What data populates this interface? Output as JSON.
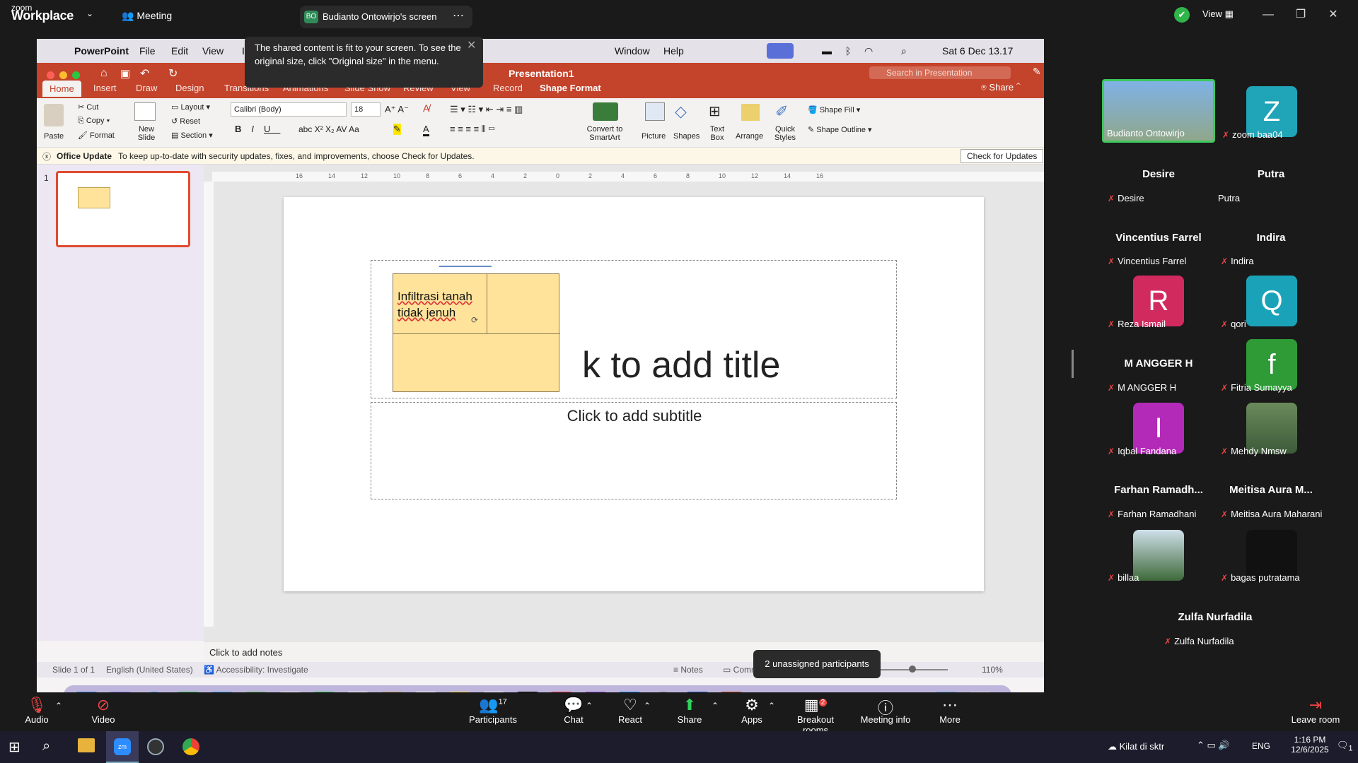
{
  "zoom": {
    "logo_top": "zoom",
    "logo_bottom": "Workplace",
    "meeting_label": "Meeting",
    "share_badge": "BO",
    "share_title": "Budianto Ontowirjo's screen",
    "view_label": "View"
  },
  "tooltip": {
    "text": "The shared content is fit to your screen. To see the original size, click \"Original size\" in the menu."
  },
  "mac_menu": {
    "apple": "",
    "app": "PowerPoint",
    "items": [
      "File",
      "Edit",
      "View",
      "In"
    ],
    "right": [
      "Window",
      "Help"
    ],
    "datetime": "Sat 6 Dec  13.17"
  },
  "ppt": {
    "title": "Presentation1",
    "search_placeholder": "Search in Presentation",
    "share": "Share",
    "tabs": [
      "Home",
      "Insert",
      "Draw",
      "Design",
      "Transitions",
      "Animations",
      "Slide Show",
      "Review",
      "View",
      "Record",
      "Shape Format"
    ],
    "ribbon": {
      "paste": "Paste",
      "cut": "Cut",
      "copy": "Copy",
      "format": "Format",
      "new_slide": "New Slide",
      "layout": "Layout",
      "reset": "Reset",
      "section": "Section",
      "font": "Calibri (Body)",
      "size": "18",
      "convert": "Convert to SmartArt",
      "picture": "Picture",
      "shapes": "Shapes",
      "textbox": "Text Box",
      "arrange": "Arrange",
      "quick_styles": "Quick Styles",
      "shape_fill": "Shape Fill",
      "shape_outline": "Shape Outline"
    },
    "update": {
      "title": "Office Update",
      "message": "To keep up-to-date with security updates, fixes, and improvements, choose Check for Updates.",
      "button": "Check for Updates"
    },
    "slide_number": "1",
    "shape_text": "Infiltrasi tanah tidak jenuh",
    "title_placeholder": "k to add title",
    "subtitle_placeholder": "Click to add subtitle",
    "notes_placeholder": "Click to add notes",
    "status": {
      "slide": "Slide 1 of 1",
      "language": "English (United States)",
      "accessibility": "Accessibility: Investigate",
      "notes": "Notes",
      "comments": "Comments",
      "zoom": "110%"
    },
    "ruler_h": [
      "16",
      "14",
      "12",
      "10",
      "8",
      "6",
      "4",
      "2",
      "0",
      "2",
      "4",
      "6",
      "8",
      "10",
      "12",
      "14",
      "16"
    ]
  },
  "dock_tooltip": "2 unassigned participants",
  "participants": [
    {
      "label": "Budianto Ontowirjo",
      "type": "video",
      "muted": false
    },
    {
      "label": "zoom baa04",
      "letter": "Z",
      "color": "#20a4b8",
      "muted": true
    },
    {
      "label": "Desire",
      "big": "Desire",
      "muted": true
    },
    {
      "label": "Putra",
      "big": "Putra",
      "muted": false
    },
    {
      "label": "Vincentius Farrel",
      "big": "Vincentius Farrel",
      "muted": true
    },
    {
      "label": "Indira",
      "big": "Indira",
      "muted": true
    },
    {
      "label": "Reza Ismail",
      "letter": "R",
      "color": "#d12a5e",
      "muted": true
    },
    {
      "label": "qori",
      "letter": "Q",
      "color": "#1aa3b8",
      "muted": true
    },
    {
      "label": "M ANGGER H",
      "big": "M ANGGER H",
      "muted": true
    },
    {
      "label": "Fitria Sumayya",
      "letter": "f",
      "color": "#2e9b37",
      "muted": true
    },
    {
      "label": "Iqbal Fandana",
      "letter": "I",
      "color": "#b42ab8",
      "muted": true
    },
    {
      "label": "Mehdy Nmsw",
      "type": "photo",
      "muted": true
    },
    {
      "label": "Farhan Ramadhani",
      "big": "Farhan Ramadh...",
      "muted": true
    },
    {
      "label": "Meitisa Aura Maharani",
      "big": "Meitisa Aura M...",
      "muted": true
    },
    {
      "label": "billaa",
      "type": "photo",
      "muted": true
    },
    {
      "label": "bagas putratama",
      "type": "dark",
      "muted": true
    },
    {
      "label": "Zulfa Nurfadila",
      "big": "Zulfa Nurfadila",
      "muted": true
    }
  ],
  "toolbar": {
    "audio": "Audio",
    "video": "Video",
    "participants": "Participants",
    "participants_count": "17",
    "chat": "Chat",
    "react": "React",
    "share": "Share",
    "apps": "Apps",
    "breakout": "Breakout rooms",
    "breakout_count": "2",
    "info": "Meeting info",
    "more": "More",
    "leave": "Leave room"
  },
  "taskbar": {
    "weather": "Kilat di sktr",
    "lang": "ENG",
    "time": "1:16 PM",
    "date": "12/6/2025",
    "notif": "1"
  }
}
